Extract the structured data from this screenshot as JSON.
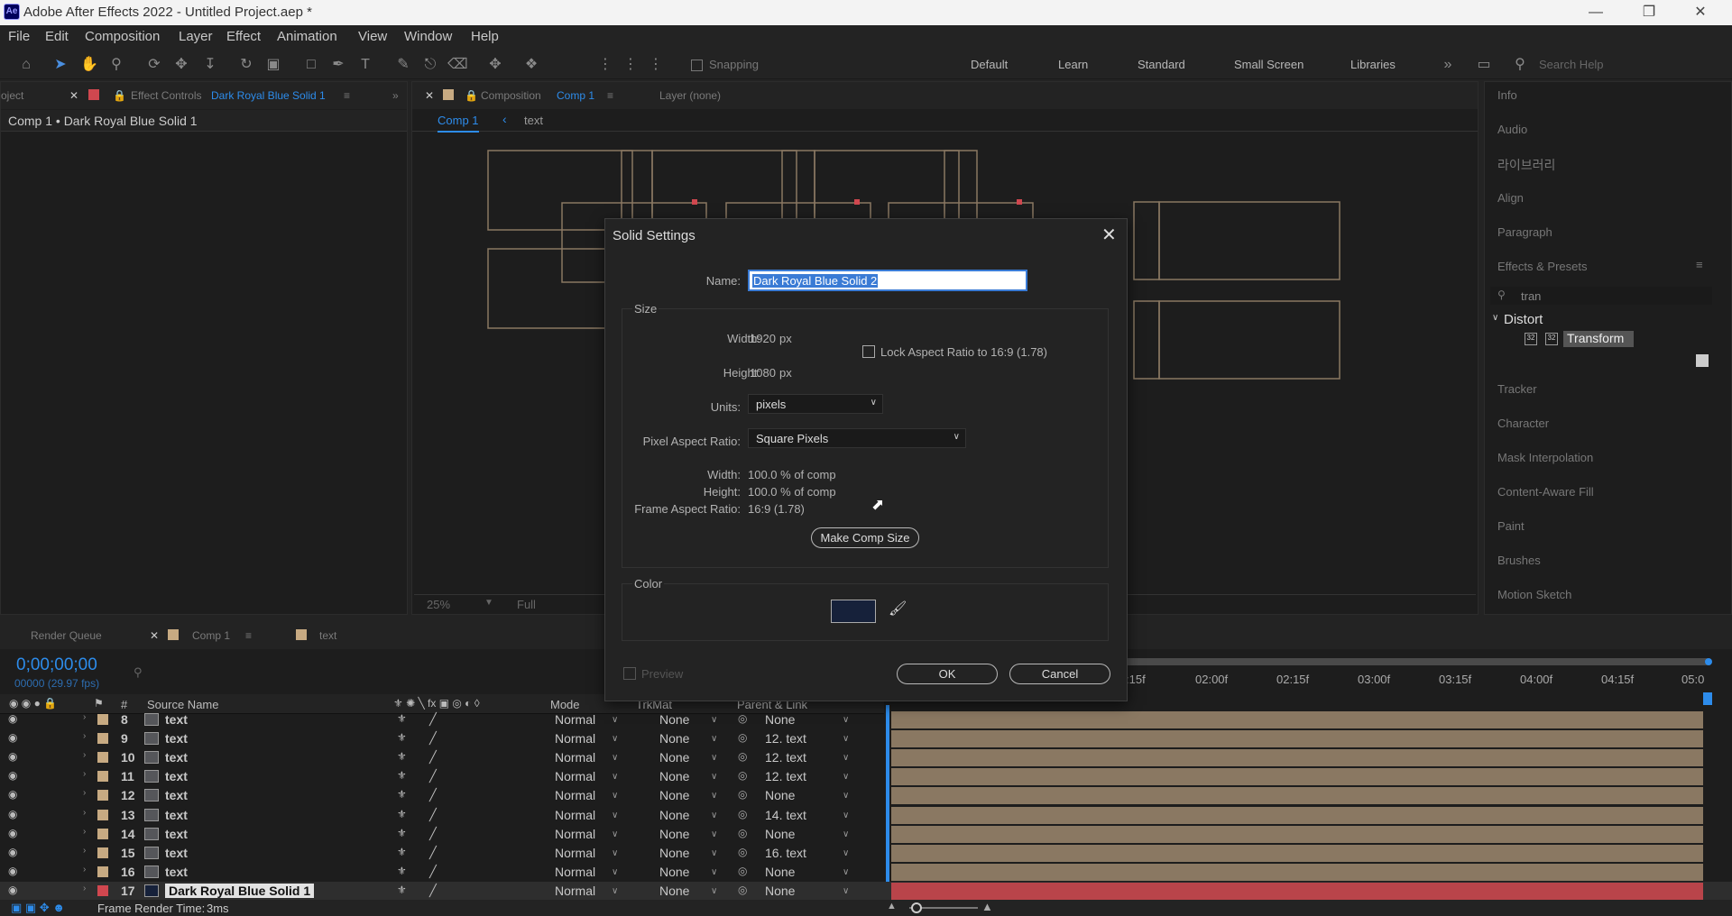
{
  "window": {
    "title": "Adobe After Effects 2022 - Untitled Project.aep *",
    "app_icon": "Ae",
    "controls": [
      "minimize-icon",
      "restore-icon",
      "close-icon"
    ]
  },
  "menu": [
    "File",
    "Edit",
    "Composition",
    "Layer",
    "Effect",
    "Animation",
    "View",
    "Window",
    "Help"
  ],
  "toolbar": {
    "snapping_label": "Snapping",
    "workspaces": [
      "Default",
      "Learn",
      "Standard",
      "Small Screen",
      "Libraries"
    ],
    "search_placeholder": "Search Help"
  },
  "project_panel": {
    "tab_label": "oject"
  },
  "effect_controls": {
    "tab_prefix": "Effect Controls",
    "tab_layer": "Dark Royal Blue Solid 1",
    "header": "Comp 1 • Dark Royal Blue Solid 1"
  },
  "composition_panel": {
    "tab_prefix": "Composition",
    "tab_comp": "Comp 1",
    "layer_tab": "Layer (none)",
    "breadcrumb_comp": "Comp 1",
    "breadcrumb_text": "text",
    "zoom": "25%",
    "resolution": "Full"
  },
  "right_panel": {
    "items": [
      "Info",
      "Audio",
      "라이브러리",
      "Align",
      "Paragraph",
      "Effects & Presets"
    ],
    "search_value": "tran",
    "tree_group": "Distort",
    "tree_item": "Transform",
    "bottom_items": [
      "Tracker",
      "Character",
      "Mask Interpolation",
      "Content-Aware Fill",
      "Paint",
      "Brushes",
      "Motion Sketch"
    ]
  },
  "timeline": {
    "tabs": [
      "Render Queue",
      "Comp 1",
      "text"
    ],
    "timecode": "0;00;00;00",
    "fps": "00000 (29.97 fps)",
    "columns": {
      "num": "#",
      "source": "Source Name",
      "mode": "Mode",
      "trkmat": "TrkMat",
      "parent": "Parent & Link"
    },
    "ruler": [
      ":15f",
      "02:00f",
      "02:15f",
      "03:00f",
      "03:15f",
      "04:00f",
      "04:15f",
      "05:0"
    ],
    "layers": [
      {
        "num": "8",
        "name": "text",
        "mode": "Normal",
        "trkmat": "None",
        "parent": "None"
      },
      {
        "num": "9",
        "name": "text",
        "mode": "Normal",
        "trkmat": "None",
        "parent": "12. text"
      },
      {
        "num": "10",
        "name": "text",
        "mode": "Normal",
        "trkmat": "None",
        "parent": "12. text"
      },
      {
        "num": "11",
        "name": "text",
        "mode": "Normal",
        "trkmat": "None",
        "parent": "12. text"
      },
      {
        "num": "12",
        "name": "text",
        "mode": "Normal",
        "trkmat": "None",
        "parent": "None"
      },
      {
        "num": "13",
        "name": "text",
        "mode": "Normal",
        "trkmat": "None",
        "parent": "14. text"
      },
      {
        "num": "14",
        "name": "text",
        "mode": "Normal",
        "trkmat": "None",
        "parent": "None"
      },
      {
        "num": "15",
        "name": "text",
        "mode": "Normal",
        "trkmat": "None",
        "parent": "16. text"
      },
      {
        "num": "16",
        "name": "text",
        "mode": "Normal",
        "trkmat": "None",
        "parent": "None"
      },
      {
        "num": "17",
        "name": "Dark Royal Blue Solid 1",
        "mode": "Normal",
        "trkmat": "None",
        "parent": "None"
      }
    ],
    "status": "Frame Render Time:",
    "render_time": "3ms"
  },
  "dialog": {
    "title": "Solid Settings",
    "name_label": "Name:",
    "name_value": "Dark Royal Blue Solid 2",
    "size_group": "Size",
    "width_label": "Width:",
    "width_value": "1920",
    "height_label": "Height:",
    "height_value": "1080",
    "px_unit": "px",
    "lock_label": "Lock Aspect Ratio to 16:9 (1.78)",
    "units_label": "Units:",
    "units_value": "pixels",
    "par_label": "Pixel Aspect Ratio:",
    "par_value": "Square Pixels",
    "pct_width_label": "Width:",
    "pct_width_value": "100.0 % of comp",
    "pct_height_label": "Height:",
    "pct_height_value": "100.0 % of comp",
    "far_label": "Frame Aspect Ratio:",
    "far_value": "16:9 (1.78)",
    "make_comp_size": "Make Comp Size",
    "color_group": "Color",
    "color_hex": "#16213a",
    "preview_label": "Preview",
    "ok_label": "OK",
    "cancel_label": "Cancel"
  },
  "colors": {
    "accent": "#2d8ceb",
    "label_tan": "#c7aa82",
    "label_red": "#d0474f",
    "bar_tan": "#8a7862",
    "bar_red": "#b9444a"
  }
}
